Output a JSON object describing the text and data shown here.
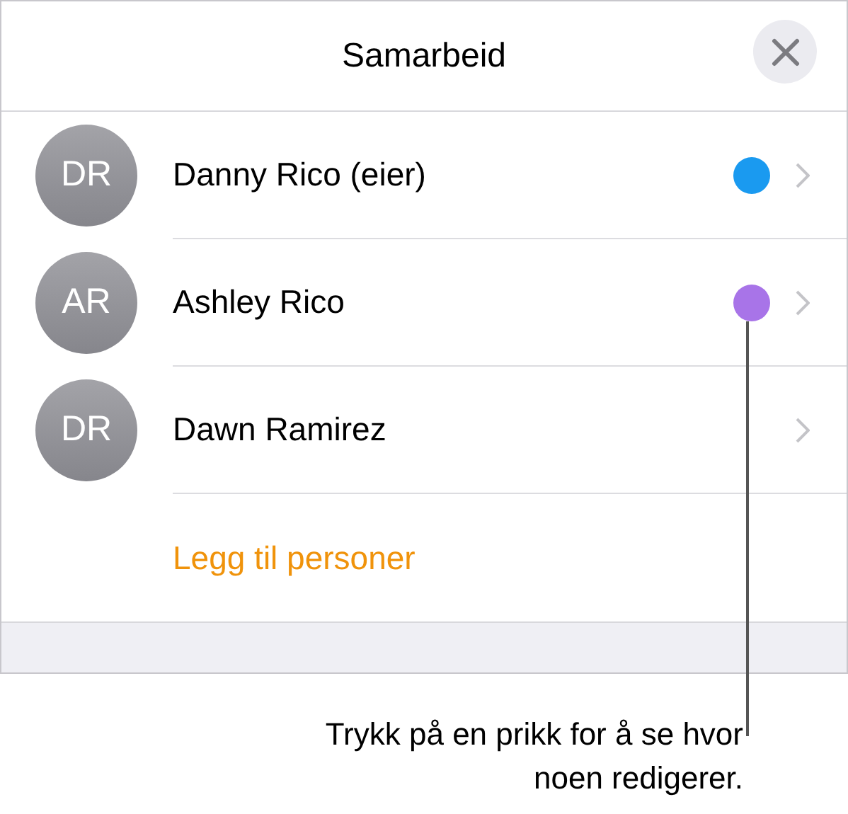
{
  "title": "Samarbeid",
  "people": [
    {
      "initials": "DR",
      "name": "Danny Rico (eier)",
      "color": "#1a9af0"
    },
    {
      "initials": "AR",
      "name": "Ashley Rico",
      "color": "#a874e8"
    },
    {
      "initials": "DR",
      "name": "Dawn Ramirez"
    }
  ],
  "add_people": "Legg til personer",
  "callout": "Trykk på en prikk for å se hvor noen redigerer."
}
